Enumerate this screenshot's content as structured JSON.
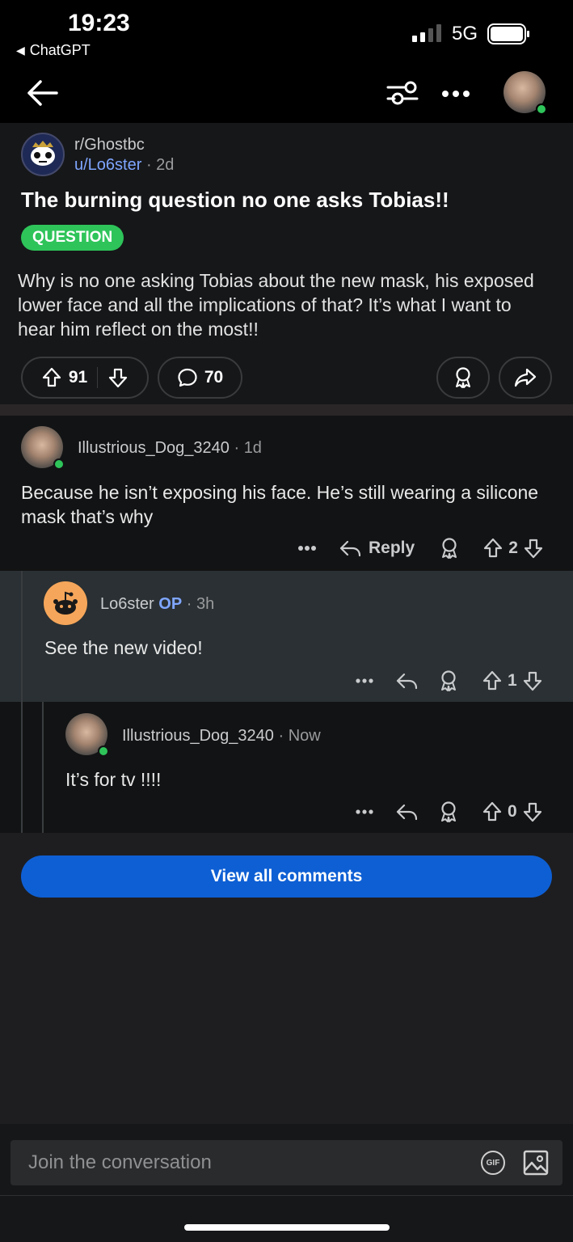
{
  "status_bar": {
    "time": "19:23",
    "back_app": "ChatGPT",
    "network": "5G"
  },
  "post": {
    "subreddit": "r/Ghostbc",
    "author": "u/Lo6ster",
    "age": "2d",
    "title": "The burning question no one asks Tobias!!",
    "flair": "QUESTION",
    "body": "Why is no one asking Tobias about the new mask, his exposed lower face and all the implications of that? It’s what I want to hear him reflect on the most!!",
    "votes": "91",
    "comments": "70"
  },
  "comments": [
    {
      "author": "Illustrious_Dog_3240",
      "age": "1d",
      "text": "Because he isn’t exposing his face. He’s still wearing a silicone mask that’s why",
      "reply_label": "Reply",
      "votes": "2"
    },
    {
      "author": "Lo6ster",
      "op_badge": "OP",
      "age": "3h",
      "text": "See the new video!",
      "votes": "1"
    },
    {
      "author": "Illustrious_Dog_3240",
      "age": "Now",
      "text": "It’s for tv !!!!",
      "votes": "0"
    }
  ],
  "view_all_label": "View all comments",
  "composer": {
    "placeholder": "Join the conversation",
    "gif_label": "GIF"
  },
  "colors": {
    "accent_blue": "#0e5fd4",
    "flair_green": "#2ec45a",
    "link_blue": "#7fa6ff"
  },
  "icons": [
    "back-arrow-icon",
    "filter-icon",
    "more-icon",
    "upvote-icon",
    "downvote-icon",
    "comment-icon",
    "award-icon",
    "share-icon",
    "reply-icon",
    "gif-icon",
    "image-icon"
  ]
}
